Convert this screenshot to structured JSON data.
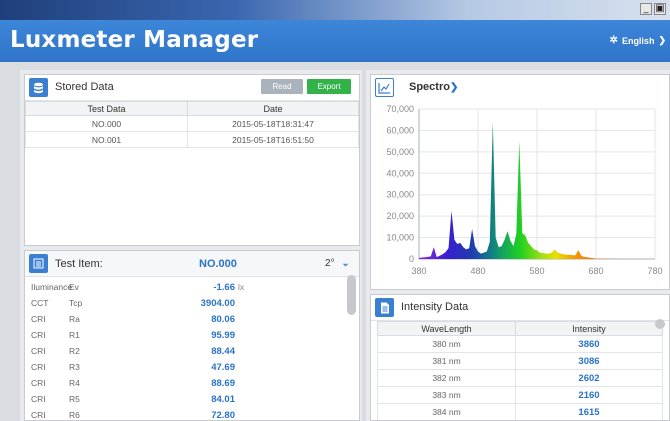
{
  "window": {
    "minimize_glyph": "_",
    "restore_glyph": "▣"
  },
  "app": {
    "title": "Luxmeter Manager",
    "language": "English"
  },
  "stored_data": {
    "title": "Stored Data",
    "read_label": "Read",
    "export_label": "Export",
    "columns": [
      "Test Data",
      "Date"
    ],
    "rows": [
      {
        "test_data": "NO.000",
        "date": "2015-05-18T18:31:47"
      },
      {
        "test_data": "NO.001",
        "date": "2015-05-18T16:51:50"
      }
    ]
  },
  "test_item": {
    "title": "Test Item:",
    "id": "NO.000",
    "angle": "2°",
    "rows": [
      {
        "group": "Iluminance",
        "param": "Ev",
        "value": "-1.66",
        "unit": "lx"
      },
      {
        "group": "CCT",
        "param": "Tcp",
        "value": "3904.00",
        "unit": ""
      },
      {
        "group": "CRI",
        "param": "Ra",
        "value": "80.06",
        "unit": ""
      },
      {
        "group": "CRI",
        "param": "R1",
        "value": "95.99",
        "unit": ""
      },
      {
        "group": "CRI",
        "param": "R2",
        "value": "88.44",
        "unit": ""
      },
      {
        "group": "CRI",
        "param": "R3",
        "value": "47.69",
        "unit": ""
      },
      {
        "group": "CRI",
        "param": "R4",
        "value": "88.69",
        "unit": ""
      },
      {
        "group": "CRI",
        "param": "R5",
        "value": "84.01",
        "unit": ""
      },
      {
        "group": "CRI",
        "param": "R6",
        "value": "72.80",
        "unit": ""
      }
    ]
  },
  "spectro": {
    "title": "Spectro",
    "chart_data": {
      "type": "area",
      "title": "",
      "xlabel": "",
      "ylabel": "",
      "xlim": [
        380,
        780
      ],
      "ylim": [
        0,
        70000
      ],
      "grid": true,
      "x_ticks": [
        380,
        480,
        580,
        680,
        780
      ],
      "y_ticks": [
        "0",
        "10,000",
        "20,000",
        "30,000",
        "40,000",
        "50,000",
        "60,000",
        "70,000"
      ],
      "series": [
        {
          "x": [
            380,
            390,
            400,
            405,
            410,
            415,
            420,
            425,
            430,
            435,
            440,
            445,
            450,
            455,
            460,
            465,
            470,
            475,
            480,
            485,
            490,
            495,
            500,
            505,
            510,
            515,
            520,
            525,
            530,
            535,
            540,
            545,
            550,
            555,
            560,
            565,
            570,
            575,
            580,
            585,
            590,
            595,
            600,
            605,
            610,
            615,
            620,
            625,
            630,
            635,
            640,
            645,
            650,
            655,
            660,
            665,
            670,
            675,
            680,
            690,
            700,
            710,
            720,
            740,
            760,
            780
          ],
          "y": [
            500,
            800,
            1200,
            5500,
            900,
            1500,
            2200,
            3200,
            5000,
            22500,
            9000,
            7000,
            7500,
            5500,
            4500,
            5000,
            14000,
            6000,
            3500,
            2500,
            3000,
            3500,
            8000,
            64000,
            10000,
            5500,
            6000,
            9000,
            13000,
            8500,
            6000,
            11500,
            55000,
            12000,
            11000,
            7500,
            6000,
            4500,
            4000,
            3000,
            2800,
            2500,
            2500,
            3000,
            4500,
            3000,
            2500,
            2200,
            2000,
            2000,
            1800,
            1700,
            4200,
            1500,
            1000,
            800,
            600,
            400,
            200,
            100,
            50,
            30,
            0,
            0,
            0,
            0
          ]
        }
      ]
    }
  },
  "intensity": {
    "title": "Intensity Data",
    "columns": [
      "WaveLength",
      "Intensity"
    ],
    "rows": [
      {
        "wl": "380 nm",
        "val": "3860"
      },
      {
        "wl": "381 nm",
        "val": "3086"
      },
      {
        "wl": "382 nm",
        "val": "2602"
      },
      {
        "wl": "383 nm",
        "val": "2160"
      },
      {
        "wl": "384 nm",
        "val": "1615"
      }
    ]
  },
  "colors": {
    "header": "#3580d2",
    "accent_blue": "#2a73c8",
    "read_button": "#a9b2bd",
    "export_button": "#34b24a"
  }
}
